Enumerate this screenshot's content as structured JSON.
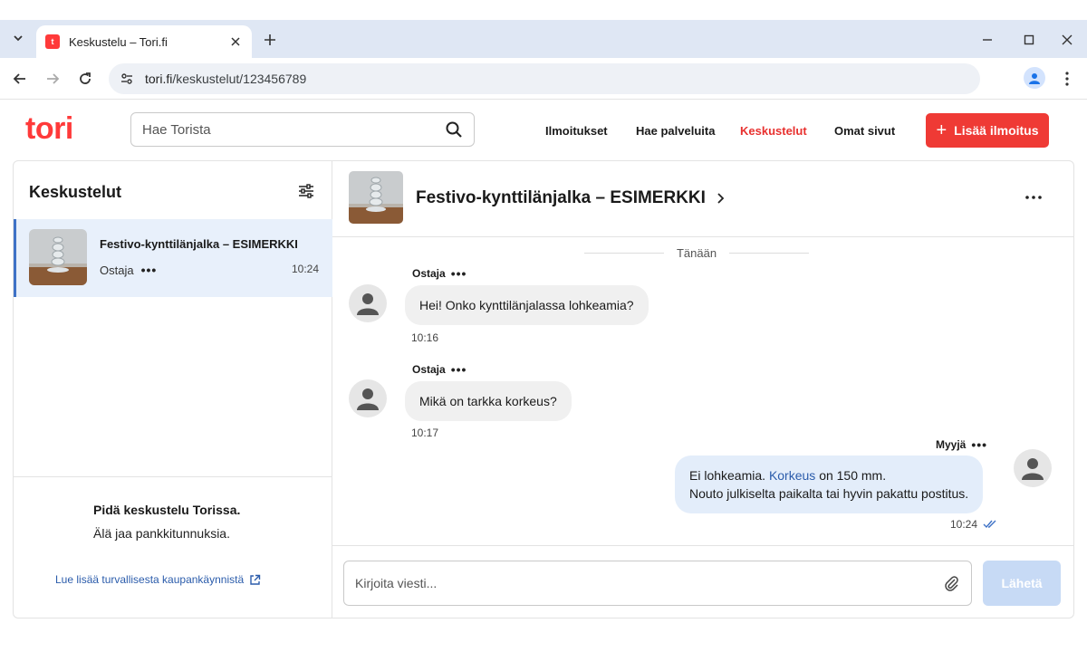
{
  "browser": {
    "tab_title": "Keskustelu – Tori.fi",
    "favicon_text": "t",
    "url_host": "tori.fi",
    "url_path": "/keskustelut/123456789"
  },
  "header": {
    "logo": "tori",
    "search_placeholder": "Hae Torista",
    "nav": [
      "Ilmoitukset",
      "Hae palveluita",
      "Keskustelut",
      "Omat sivut"
    ],
    "active_nav": "Keskustelut",
    "cta_label": "Lisää ilmoitus",
    "brand_color": "#ef3a35"
  },
  "sidebar": {
    "title": "Keskustelut",
    "conversations": [
      {
        "title": "Festivo-kynttilänjalka – ESIMERKKI",
        "role": "Ostaja",
        "time": "10:24"
      }
    ],
    "footer": {
      "strong": "Pidä keskustelu Torissa.",
      "text": "Älä jaa pankkitunnuksia.",
      "link": "Lue lisää turvallisesta kaupankäynnistä"
    }
  },
  "chat": {
    "title": "Festivo-kynttilänjalka – ESIMERKKI",
    "day_separator": "Tänään",
    "messages": [
      {
        "sender": "Ostaja",
        "text": "Hei! Onko kynttilänjalassa lohkeamia?",
        "time": "10:16"
      },
      {
        "sender": "Ostaja",
        "text": "Mikä on tarkka korkeus?",
        "time": "10:17"
      },
      {
        "sender": "Myyjä",
        "line1_pre": "Ei lohkeamia.",
        "line1_link": "Korkeus",
        "line1_post": "on 150 mm.",
        "line2": "Nouto julkiselta paikalta tai hyvin pakattu postitus.",
        "time": "10:24"
      }
    ],
    "composer_placeholder": "Kirjoita viesti...",
    "send_label": "Lähetä"
  },
  "icons": {
    "tab_dropdown": "chevron-down-icon",
    "back": "arrow-left-icon",
    "forward": "arrow-right-icon",
    "reload": "reload-icon",
    "site_info": "tune-icon",
    "search": "search-icon",
    "filter": "sliders-icon",
    "external": "external-link-icon",
    "attach": "paperclip-icon",
    "read": "double-check-icon"
  }
}
